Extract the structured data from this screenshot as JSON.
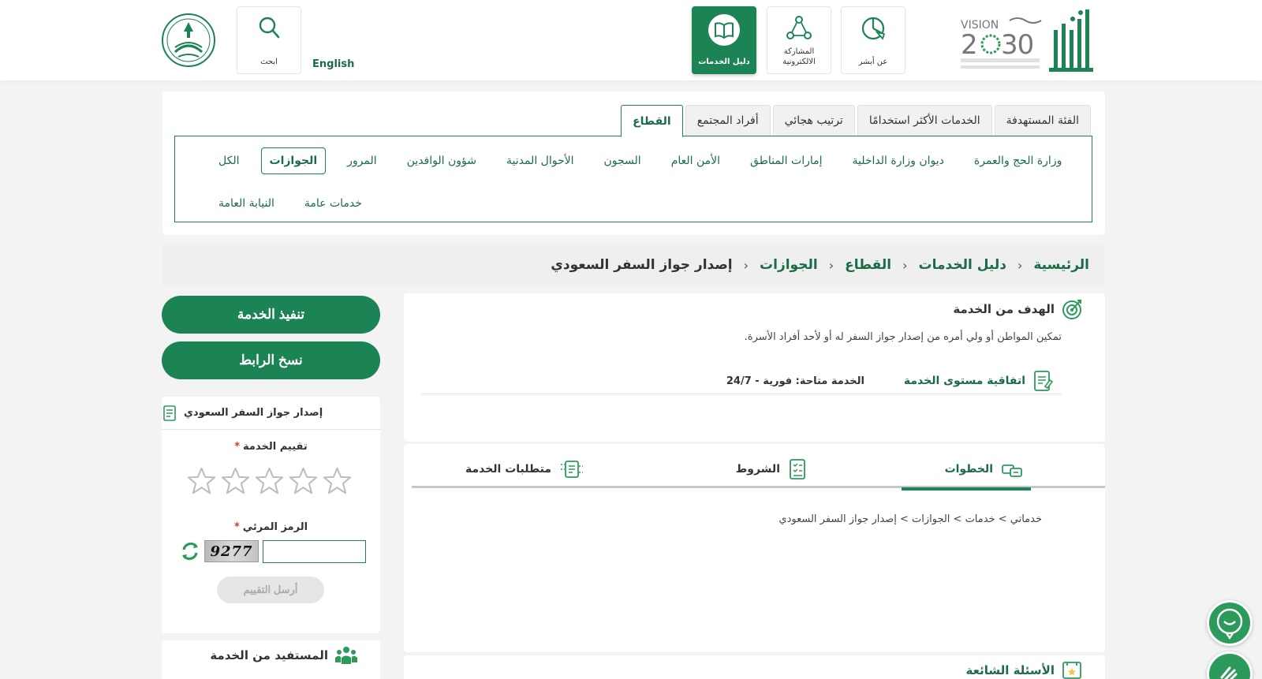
{
  "header": {
    "nav": [
      {
        "id": "about",
        "label": "عن أبشر",
        "icon": "pie-chart-icon"
      },
      {
        "id": "eparticipation",
        "label": "المشاركة الالكترونية",
        "icon": "network-icon"
      },
      {
        "id": "services-guide",
        "label": "دليل الخدمات",
        "icon": "book-icon",
        "active": true
      }
    ],
    "search_label": "ابحث",
    "language_link": "English"
  },
  "sector_panel": {
    "tabs": [
      {
        "label": "القطاع",
        "active": true
      },
      {
        "label": "أفراد المجتمع"
      },
      {
        "label": "ترتيب هجائي"
      },
      {
        "label": "الخدمات الأكثر استخدامًا"
      },
      {
        "label": "الفئة المستهدفة"
      }
    ],
    "sectors": [
      {
        "label": "الكل"
      },
      {
        "label": "الجوازات",
        "active": true
      },
      {
        "label": "المرور"
      },
      {
        "label": "شؤون الوافدين"
      },
      {
        "label": "الأحوال المدنية"
      },
      {
        "label": "السجون"
      },
      {
        "label": "الأمن العام"
      },
      {
        "label": "إمارات المناطق"
      },
      {
        "label": "ديوان وزارة الداخلية"
      },
      {
        "label": "وزارة الحج والعمرة"
      },
      {
        "label": "النيابة العامة"
      },
      {
        "label": "خدمات عامة"
      }
    ]
  },
  "breadcrumb": {
    "items": [
      "الرئيسية",
      "دليل الخدمات",
      "القطاع",
      "الجوازات",
      "إصدار جواز السفر السعودي"
    ],
    "separator": "›"
  },
  "goal": {
    "title": "الهدف من الخدمة",
    "description": "تمكين المواطن أو ولي أمره من إصدار جواز السفر له أو لأحد أفراد الأسرة.",
    "sla_label": "اتفاقية مستوى الخدمة",
    "sla_value": "الخدمة متاحة: فورية - 24/7"
  },
  "steps": {
    "tabs": [
      {
        "label": "الخطوات",
        "active": true
      },
      {
        "label": "الشروط"
      },
      {
        "label": "متطلبات الخدمة"
      }
    ],
    "path": "خدماتي > خدمات > الجوازات > إصدار جواز السفر السعودي"
  },
  "faq": {
    "title": "الأسئلة الشائعة"
  },
  "side": {
    "execute_label": "تنفيذ الخدمة",
    "copy_link_label": "نسخ الرابط",
    "rating": {
      "service_name": "إصدار جواز السفر السعودي",
      "rate_label": "تقييم الخدمة",
      "required_mark": "*",
      "captcha_label": "الرمز المرئي",
      "captcha_text": "9277",
      "captcha_value": "",
      "send_label": "أرسل التقييم",
      "stars_total": 5,
      "stars_selected": 0
    },
    "beneficiary_title": "المستفيد من الخدمة"
  },
  "colors": {
    "primary": "#1b8354",
    "primary_text": "#1b6c46",
    "background": "#f3f3f3"
  }
}
